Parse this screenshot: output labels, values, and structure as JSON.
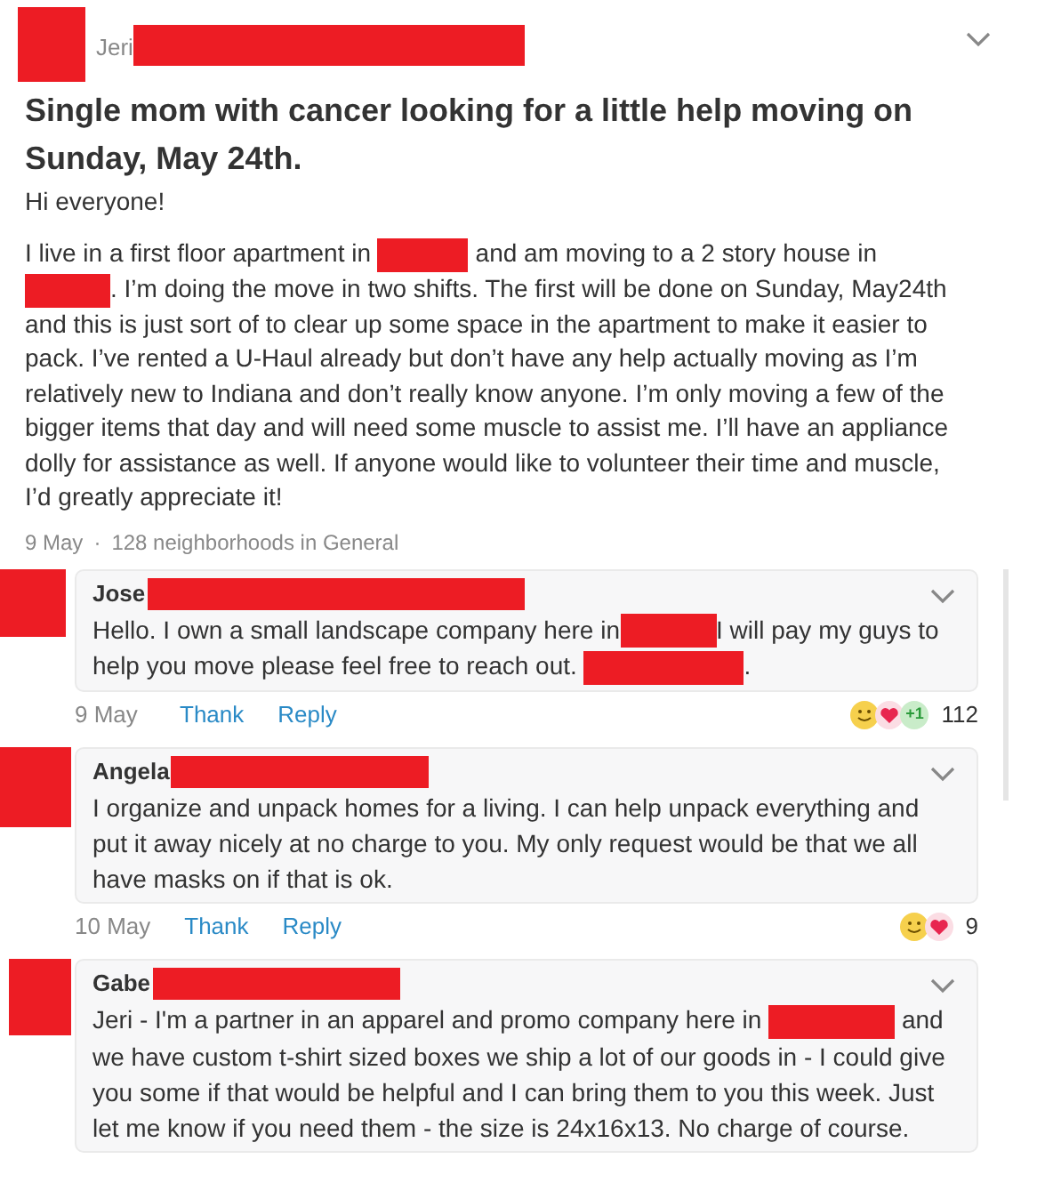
{
  "post": {
    "author": "Jeri",
    "title": "Single mom with cancer looking for a little help moving on Sunday, May 24th.",
    "greeting": "Hi everyone!",
    "body": [
      {
        "kind": "text",
        "text": "I live in a first floor apartment in "
      },
      {
        "kind": "redaction"
      },
      {
        "kind": "text",
        "text": " and am moving to a 2 story house in "
      },
      {
        "kind": "redaction"
      },
      {
        "kind": "text",
        "text": ". I’m doing the move in two shifts. The first will be done on Sunday, May24th and this is just sort of to clear up some space in the apartment to make it easier to pack. I’ve rented a U-Haul already but don’t have any help actually moving as I’m relatively new to Indiana and don’t really know anyone. I’m only moving a few of the bigger items that day and will need some muscle to assist me. I’ll have an appliance dolly for assistance as well. If anyone would like to volunteer their time and muscle, I’d greatly appreciate it!"
      }
    ],
    "date": "9 May",
    "separator": "·",
    "audience": "128 neighborhoods in General"
  },
  "comments": [
    {
      "author": "Jose",
      "body": [
        {
          "kind": "text",
          "text": "Hello. I own a small landscape company here in"
        },
        {
          "kind": "redaction"
        },
        {
          "kind": "text",
          "text": "I will pay my guys to help you move please feel free to reach out. "
        },
        {
          "kind": "redaction"
        },
        {
          "kind": "text",
          "text": "."
        }
      ],
      "date": "9 May",
      "actions": [
        "Thank",
        "Reply"
      ],
      "reactions": [
        {
          "kind": "smile"
        },
        {
          "kind": "heart"
        },
        {
          "kind": "plus-one",
          "text": "+1"
        }
      ],
      "reaction_count": "112"
    },
    {
      "author": "Angela",
      "body": [
        {
          "kind": "text",
          "text": "I organize and unpack homes for a living. I can help unpack everything and put it away nicely at no charge to you. My only request would be that we all have masks on if that is ok."
        }
      ],
      "date": "10 May",
      "actions": [
        "Thank",
        "Reply"
      ],
      "reactions": [
        {
          "kind": "smile"
        },
        {
          "kind": "heart"
        }
      ],
      "reaction_count": "9"
    },
    {
      "author": "Gabe",
      "body": [
        {
          "kind": "text",
          "text": "Jeri - I'm a partner in an apparel and promo company here in "
        },
        {
          "kind": "redaction"
        },
        {
          "kind": "text",
          "text": " and we have custom t-shirt sized boxes we ship a lot of our goods in - I could give you some if that would be helpful and I can bring them to you this week. Just let me know if you need them - the size is 24x16x13. No charge of course."
        }
      ]
    }
  ]
}
